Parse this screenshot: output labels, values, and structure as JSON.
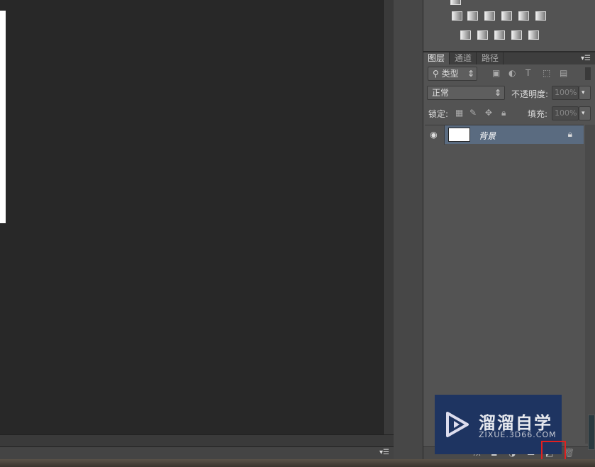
{
  "layers_panel": {
    "tabs": [
      {
        "label": "图层",
        "active": true
      },
      {
        "label": "通道"
      },
      {
        "label": "路径"
      }
    ],
    "menu_icon": "panel-menu-icon",
    "filter_kind": "类型",
    "blend_mode": "正常",
    "opacity_label": "不透明度:",
    "opacity_value": "100%",
    "lock_label": "锁定:",
    "fill_label": "填充:",
    "fill_value": "100%",
    "layers": [
      {
        "name": "背景",
        "visible": true,
        "locked": true,
        "selected": true
      }
    ]
  },
  "watermark": {
    "title": "溜溜自学",
    "url": "ZIXUE.3D66.COM"
  },
  "colors": {
    "highlight": "#e02020",
    "selected_layer": "#5a6b80"
  }
}
